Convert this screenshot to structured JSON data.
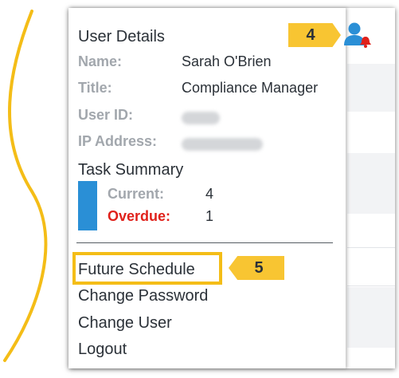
{
  "user_details": {
    "heading": "User Details",
    "name_label": "Name:",
    "name_value": "Sarah O'Brien",
    "title_label": "Title:",
    "title_value": "Compliance Manager",
    "user_id_label": "User ID:",
    "ip_label": "IP Address:"
  },
  "task_summary": {
    "heading": "Task Summary",
    "current_label": "Current:",
    "current_value": "4",
    "overdue_label": "Overdue:",
    "overdue_value": "1"
  },
  "menu_items": [
    "Future Schedule",
    "Change Password",
    "Change User",
    "Logout"
  ],
  "callouts": {
    "user_icon_step": "4",
    "future_schedule_step": "5"
  },
  "icons": {
    "user": "user-alert-icon"
  },
  "colors": {
    "accent_blue": "#2a8fd6",
    "overdue_red": "#e0211b",
    "callout_yellow": "#f8c532",
    "highlight_border": "#f4bd17"
  }
}
